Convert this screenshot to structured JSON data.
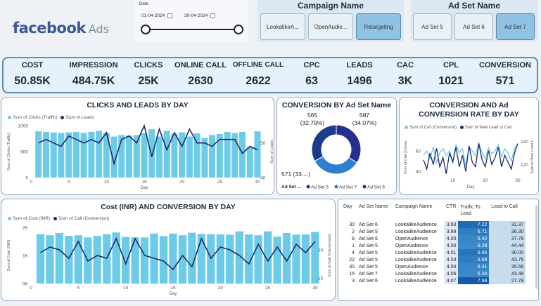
{
  "logo": {
    "brand": "facebook",
    "suffix": "Ads"
  },
  "date_filter": {
    "label": "Date",
    "start": "01-04-2024",
    "end": "30-04-2024",
    "range_fraction": [
      0,
      1
    ]
  },
  "campaign_slicer": {
    "title": "Campaign Name",
    "options": [
      "LookalikeA...",
      "OpenAudie...",
      "Retargeting"
    ],
    "selected": "Retargeting"
  },
  "adset_slicer": {
    "title": "Ad Set Name",
    "options": [
      "Ad Set 5",
      "Ad Set 6",
      "Ad Set 7"
    ],
    "selected": "Ad Set 7"
  },
  "kpis": [
    {
      "label": "COST",
      "value": "50.85K"
    },
    {
      "label": "IMPRESSION",
      "value": "484.75K"
    },
    {
      "label": "CLICKS",
      "value": "25K"
    },
    {
      "label": "ONLINE CALL",
      "value": "2630"
    },
    {
      "label": "OFFLINE CALL",
      "value": "2622"
    },
    {
      "label": "CPC",
      "value": "63"
    },
    {
      "label": "LEADS",
      "value": "1496"
    },
    {
      "label": "CAC",
      "value": "3K"
    },
    {
      "label": "CPL",
      "value": "1021"
    },
    {
      "label": "CONVERSION",
      "value": "571"
    }
  ],
  "colors": {
    "bar": "#6ccbe8",
    "line": "#1c2a6b",
    "donut": [
      "#1e3a8a",
      "#2f7fd0",
      "#25308c"
    ],
    "kpi_border": "#5a8cb5"
  },
  "chart_data": [
    {
      "type": "bar",
      "title": "CLICKS AND LEADS BY DAY",
      "xlabel": "Day",
      "ylabel": "Sum of Clicks (Traffic)",
      "y2label": "Sum of Leads",
      "legend": [
        "Sum of Clicks (Traffic)",
        "Sum of Leads"
      ],
      "x": [
        1,
        2,
        3,
        4,
        5,
        6,
        7,
        8,
        9,
        10,
        11,
        12,
        13,
        14,
        15,
        16,
        17,
        18,
        19,
        20,
        21,
        22,
        23,
        24,
        25,
        26,
        27,
        28,
        29,
        30
      ],
      "xticks": [
        0,
        5,
        10,
        15,
        20,
        25,
        30
      ],
      "ylim": [
        0,
        1000
      ],
      "yticks": [
        "0",
        "500",
        "1000"
      ],
      "y2lim": [
        40,
        55
      ],
      "y2ticks": [
        "40",
        "50"
      ],
      "series": [
        {
          "name": "Sum of Clicks (Traffic)",
          "values": [
            890,
            880,
            870,
            860,
            870,
            880,
            860,
            880,
            900,
            860,
            790,
            820,
            810,
            820,
            860,
            930,
            790,
            900,
            840,
            870,
            790,
            850,
            760,
            820,
            840,
            880,
            860,
            880,
            580,
            890
          ]
        },
        {
          "name": "Sum of Leads",
          "values": [
            50,
            51,
            50,
            49,
            52,
            51,
            50,
            51,
            50,
            53,
            44,
            51,
            52,
            50,
            55,
            46,
            54,
            48,
            53,
            49,
            54,
            50,
            50,
            49,
            51,
            51,
            51,
            47,
            49,
            48
          ]
        }
      ]
    },
    {
      "type": "pie",
      "title": "CONVERSION BY Ad Set Name",
      "legend_title": "Ad Set ...",
      "labels": [
        "Ad Set 5",
        "Ad Set 7",
        "Ad Set 6"
      ],
      "values": [
        587,
        571,
        565
      ],
      "slice_labels": [
        "587 (34.07%)",
        "571 (33....)",
        "565 (32.79%)"
      ]
    },
    {
      "type": "line",
      "title": "CONVERSION AND Ad CONVERSION RATE BY DAY",
      "xlabel": "Day",
      "ylabel": "Sum of Call (Conve...",
      "y2label": "Sum of New Lead t...",
      "legend": [
        "Sum of Call (Conversion)",
        "Sum of New Lead to Call"
      ],
      "xticks": [
        10,
        20,
        30
      ],
      "ylim": [
        35,
        75
      ],
      "yticks": [
        "40",
        "60"
      ],
      "y2lim": [
        110,
        145
      ],
      "y2ticks": [
        "120",
        "140"
      ],
      "series": [
        {
          "name": "Sum of Call (Conversion)",
          "values": [
            56,
            60,
            52,
            64,
            48,
            58,
            62,
            55,
            60,
            50,
            66,
            58,
            62,
            45,
            64,
            60,
            55,
            68,
            58,
            52,
            63,
            57,
            60,
            66,
            54,
            62,
            58,
            50,
            62,
            66
          ]
        },
        {
          "name": "Sum of New Lead to Call",
          "values": [
            124,
            116,
            130,
            120,
            134,
            118,
            126,
            112,
            130,
            122,
            135,
            118,
            128,
            114,
            136,
            122,
            118,
            138,
            124,
            118,
            132,
            120,
            126,
            135,
            118,
            128,
            122,
            116,
            130,
            138
          ]
        }
      ]
    },
    {
      "type": "bar",
      "title": "Cost (INR) AND CONVERSION BY DAY",
      "xlabel": "Day",
      "ylabel": "Sum of Cost (INR)",
      "y2label": "Sum of Call (Conversion)",
      "legend": [
        "Sum of Cost (INR)",
        "Sum of Call (Conversion)"
      ],
      "xticks": [
        0,
        5,
        10,
        15,
        20,
        25,
        30
      ],
      "ylim": [
        0,
        2000
      ],
      "yticks": [
        "0K",
        "1K",
        "2K"
      ],
      "y2lim": [
        14,
        24
      ],
      "y2ticks": [
        "15",
        "20"
      ],
      "series": [
        {
          "name": "Sum of Cost (INR)",
          "values": [
            1760,
            1720,
            1800,
            1700,
            1720,
            1640,
            1700,
            1760,
            1820,
            1660,
            1650,
            1640,
            1780,
            1690,
            1780,
            1720,
            1810,
            1770,
            1760,
            1750,
            1740,
            1860,
            1750,
            1720,
            1860,
            1670,
            1800,
            1740,
            1750,
            1840
          ]
        },
        {
          "name": "Sum of Call (Conversion)",
          "values": [
            19.5,
            20.5,
            20,
            18.5,
            21.5,
            18,
            19,
            18.5,
            22,
            17.5,
            22,
            19,
            18.5,
            18,
            16.5,
            19,
            17,
            22,
            18.5,
            20.5,
            20,
            19,
            17.5,
            21,
            18,
            20.5,
            18,
            21,
            19.5,
            21.5
          ]
        }
      ]
    },
    {
      "type": "table",
      "columns": [
        "Day",
        "Ad Set Name",
        "Campaign Name",
        "CTR",
        "Traffic To Lead",
        "Lead to Call"
      ],
      "rows": [
        [
          "30",
          "Ad Set 6",
          "LookalikeAudience",
          "3.93",
          "7.22",
          "31.37"
        ],
        [
          "2",
          "Ad Set 5",
          "LookalikeAudience",
          "3.99",
          "6.71",
          "36.30"
        ],
        [
          "8",
          "Ad Set 6",
          "OpenAudience",
          "4.00",
          "6.42",
          "37.78"
        ],
        [
          "1",
          "Ad Set 5",
          "OpenAudience",
          "4.00",
          "6.28",
          "44.44"
        ],
        [
          "4",
          "Ad Set 5",
          "LookalikeAudience",
          "4.01",
          "6.95",
          "30.00"
        ],
        [
          "22",
          "Ad Set 5",
          "LookalikeAudience",
          "4.03",
          "6.68",
          "43.75"
        ],
        [
          "30",
          "Ad Set 5",
          "OpenAudience",
          "4.04",
          "6.41",
          "35.56"
        ],
        [
          "15",
          "Ad Set 7",
          "LookalikeAudience",
          "4.06",
          "6.34",
          "43.48"
        ],
        [
          "3",
          "Ad Set 6",
          "LookalikeAudience",
          "4.07",
          "7.68",
          "27.78"
        ]
      ]
    }
  ]
}
